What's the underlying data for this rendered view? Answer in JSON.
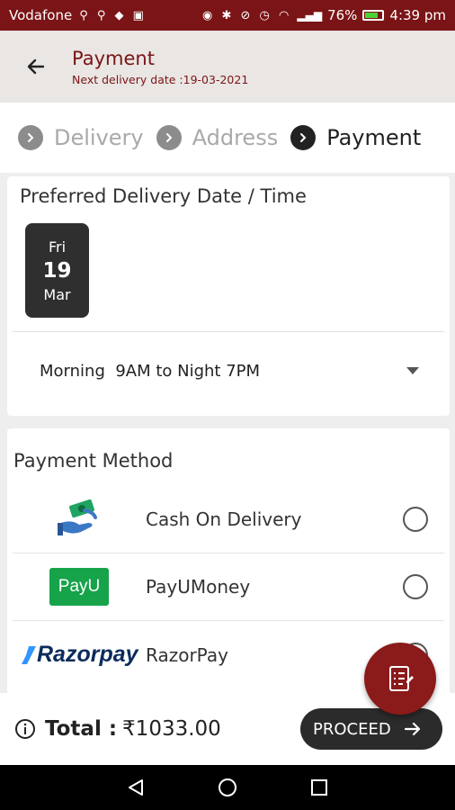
{
  "status_bar": {
    "carrier": "Vodafone",
    "battery": "76%",
    "time": "4:39 pm"
  },
  "header": {
    "title": "Payment",
    "subtitle": "Next delivery date :19-03-2021"
  },
  "stepper": {
    "steps": [
      {
        "label": "Delivery",
        "active": false
      },
      {
        "label": "Address",
        "active": false
      },
      {
        "label": "Payment",
        "active": true
      }
    ]
  },
  "delivery": {
    "title": "Preferred Delivery Date / Time",
    "date": {
      "dow": "Fri",
      "day": "19",
      "month": "Mar"
    },
    "time_slot": "Morning  9AM to Night 7PM"
  },
  "payment": {
    "title": "Payment Method",
    "methods": [
      {
        "label": "Cash On Delivery",
        "icon": "cash-hand-icon"
      },
      {
        "label": "PayUMoney",
        "icon": "payu-logo",
        "logo_text": "PayU"
      },
      {
        "label": "RazorPay",
        "icon": "razorpay-logo",
        "logo_text": "Razorpay"
      }
    ]
  },
  "footer": {
    "total_label": "Total :",
    "total_amount": "₹1033.00",
    "proceed_label": "PROCEED"
  },
  "colors": {
    "brand": "#7b1416",
    "fab": "#8b1a1a",
    "dark": "#2b2b2b"
  }
}
